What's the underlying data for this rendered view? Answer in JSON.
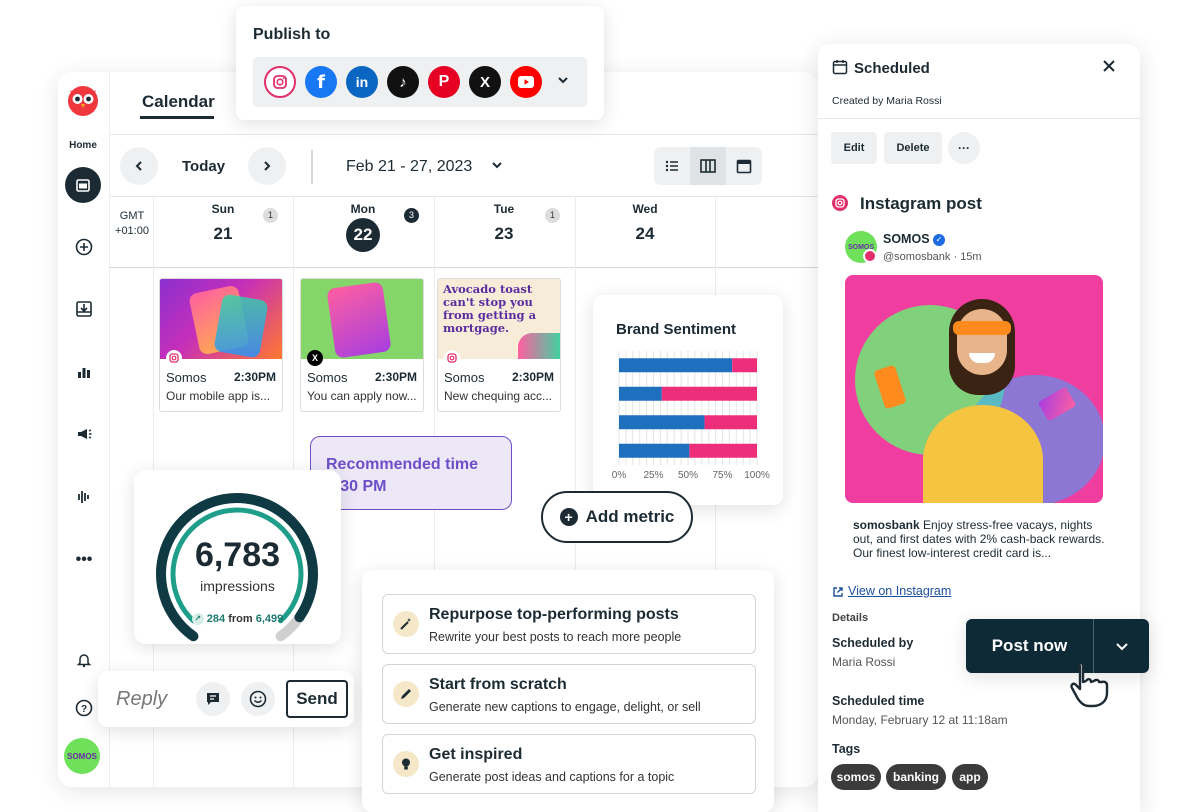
{
  "sidebar": {
    "home_label": "Home",
    "avatar_text": "SOMOS"
  },
  "calendar": {
    "title": "Calendar",
    "today_label": "Today",
    "date_range": "Feb 21 - 27, 2023",
    "timezone": "GMT +01:00",
    "days": [
      {
        "name": "Sun",
        "num": "21",
        "badge": "1"
      },
      {
        "name": "Mon",
        "num": "22",
        "badge": "3"
      },
      {
        "name": "Tue",
        "num": "23",
        "badge": "1"
      },
      {
        "name": "Wed",
        "num": "24",
        "badge": ""
      }
    ],
    "posts": [
      {
        "brand": "Somos",
        "time": "2:30PM",
        "text": "Our mobile app is..."
      },
      {
        "brand": "Somos",
        "time": "2:30PM",
        "text": "You can apply now..."
      },
      {
        "brand": "Somos",
        "time": "2:30PM",
        "text": "New chequing acc...",
        "image_text": "Avocado toast can't stop you from getting a mortgage."
      }
    ]
  },
  "publish": {
    "title": "Publish to",
    "networks": [
      "instagram-icon",
      "facebook-icon",
      "linkedin-icon",
      "tiktok-icon",
      "pinterest-icon",
      "x-icon",
      "youtube-icon"
    ]
  },
  "recommended": {
    "line1": "Recommended time",
    "line2": "2:30 PM"
  },
  "add_metric": {
    "label": "Add metric"
  },
  "chart_data": {
    "type": "bar",
    "orientation": "horizontal-stacked",
    "title": "Brand Sentiment",
    "categories": [
      "1",
      "2",
      "3",
      "4"
    ],
    "series": [
      {
        "color": "#1f6fbf",
        "values": [
          82,
          31,
          62,
          51
        ]
      },
      {
        "color": "#ee2e7a",
        "values": [
          18,
          69,
          38,
          49
        ]
      }
    ],
    "xticks": [
      "0%",
      "25%",
      "50%",
      "75%",
      "100%"
    ],
    "xlim": [
      0,
      100
    ]
  },
  "impressions": {
    "value": "6,783",
    "label": "impressions",
    "change": "284",
    "from_word": "from",
    "from_value": "6,499",
    "gauge_fraction": 0.93
  },
  "reply": {
    "placeholder": "Reply",
    "send_label": "Send"
  },
  "ai_options": [
    {
      "title": "Repurpose top-performing posts",
      "desc": "Rewrite your best posts to reach more people"
    },
    {
      "title": "Start from scratch",
      "desc": "Generate new captions to engage, delight, or sell"
    },
    {
      "title": "Get inspired",
      "desc": "Generate post ideas and captions for a topic"
    }
  ],
  "panel": {
    "title": "Scheduled",
    "created_by": "Created by Maria Rossi",
    "edit_label": "Edit",
    "delete_label": "Delete",
    "more_label": "···",
    "post_type": "Instagram post",
    "account_name": "SOMOS",
    "account_handle": "@somosbank · 15m",
    "caption_user": "somosbank",
    "caption_text": "Enjoy stress-free vacays, nights out, and first dates with 2% cash-back rewards. Our finest low-interest credit card is...",
    "view_link": "View on Instagram",
    "details_label": "Details",
    "scheduled_by_label": "Scheduled by",
    "scheduled_by_value": "Maria Rossi",
    "scheduled_time_label": "Scheduled time",
    "scheduled_time_value": "Monday, February 12 at 11:18am",
    "tags_label": "Tags",
    "tags": [
      "somos",
      "banking",
      "app"
    ]
  },
  "post_now": {
    "label": "Post now"
  },
  "colors": {
    "navy": "#1c2b33",
    "accent_purple": "#6e4ec8",
    "sentiment_blue": "#1f6fbf",
    "sentiment_pink": "#ee2e7a",
    "teal_gauge": "#1f7a6e"
  }
}
